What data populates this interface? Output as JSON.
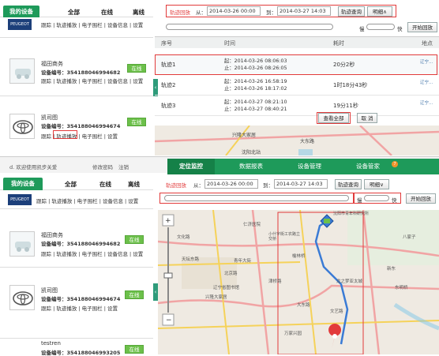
{
  "top": {
    "tabs": {
      "mine": "我的设备",
      "all": "全部",
      "online": "在线",
      "offline": "离线"
    },
    "trackbar": {
      "label": "轨迹回放",
      "from_label": "从：",
      "from": "2014-03-26 00:00",
      "to_label": "到：",
      "to": "2014-03-27 14:03",
      "query": "轨迹查询",
      "detail": "明细∧"
    },
    "speed": {
      "slow": "慢",
      "fast": "快",
      "start": "开始回放"
    },
    "table": {
      "headers": [
        "序号",
        "时间",
        "",
        "耗时",
        "",
        "地点"
      ],
      "rows": [
        {
          "name": "轨迹1",
          "start": "起：2014-03-26 08:06:03",
          "end": "止：2014-03-26 08:26:05",
          "dur": "20分2秒",
          "place": "辽宁..."
        },
        {
          "name": "轨迹2",
          "start": "起：2014-03-26 16:58:19",
          "end": "止：2014-03-26 18:17:02",
          "dur": "1时18分43秒",
          "place": "辽宁..."
        },
        {
          "name": "轨迹3",
          "start": "起：2014-03-27 08:21:10",
          "end": "止：2014-03-27 08:40:21",
          "dur": "19分11秒",
          "place": "辽宁..."
        }
      ],
      "view_all": "查看全部",
      "cancel": "取 消"
    },
    "devices": [
      {
        "brand": "PEUGEOT",
        "links": "跟踪 | 轨迹播放 | 电子围栏 | 设备信息 | 设置"
      },
      {
        "name": "福田商务",
        "id": "设备编号：354188046994682",
        "status": "在线",
        "links": "跟踪 | 轨迹播放 | 电子围栏 | 设备信息 | 设置"
      },
      {
        "name": "凯司图",
        "id": "设备编号：354188046994674",
        "status": "在线",
        "links": "跟踪 | 轨迹播放 | 电子围栏 | 设置"
      }
    ]
  },
  "bottom": {
    "header": {
      "welcome": "d. 欢迎使用凯步关爱",
      "change_pwd": "修改密码",
      "logout": "注销"
    },
    "nav": [
      "定位监控",
      "数据报表",
      "设备管理",
      "设备管家"
    ],
    "badge": "7",
    "tabs": {
      "mine": "我的设备",
      "all": "全部",
      "online": "在线",
      "offline": "离线"
    },
    "trackbar": {
      "label": "轨迹回放",
      "from_label": "从：",
      "from": "2014-03-26 00:00",
      "to_label": "到：",
      "to": "2014-03-27 14:03",
      "query": "轨迹查询",
      "detail": "明细∨"
    },
    "speed": {
      "slow": "慢",
      "fast": "快",
      "start": "开始回放"
    },
    "devices": [
      {
        "brand": "PEUGEOT",
        "links": "跟踪 | 轨迹播放 | 电子围栏 | 设备信息 | 设置"
      },
      {
        "name": "福田商务",
        "id": "设备编号：354188046994682",
        "status": "在线",
        "links": "跟踪 | 轨迹播放 | 电子围栏 | 设备信息 | 设置"
      },
      {
        "name": "凯司图",
        "id": "设备编号：354188046994674",
        "status": "在线",
        "links": "跟踪 | 轨迹播放 | 电子围栏 | 设置"
      },
      {
        "name": "testren",
        "id": "设备编号：354188046993205",
        "status": "在线"
      }
    ],
    "map_labels": [
      "仁济医院",
      "沈阳市青年科研究所",
      "文化路",
      "小什字街工农路立交桥",
      "福昌北",
      "北陵北",
      "天坛东路",
      "青年大街",
      "辽宁省图书馆",
      "沈阳市西",
      "北京路",
      "津桥路",
      "旧京大街",
      "文艺路",
      "新东",
      "榆林桥",
      "东华街",
      "兴隆大家居",
      "大东路",
      "万家兴园",
      "龙之梦亚太城",
      "江",
      "东明桥",
      "八家子",
      "长青街"
    ]
  },
  "colors": {
    "accent": "#1e9a5a",
    "highlight": "#e23b3b",
    "route": "#3a7bd5"
  }
}
